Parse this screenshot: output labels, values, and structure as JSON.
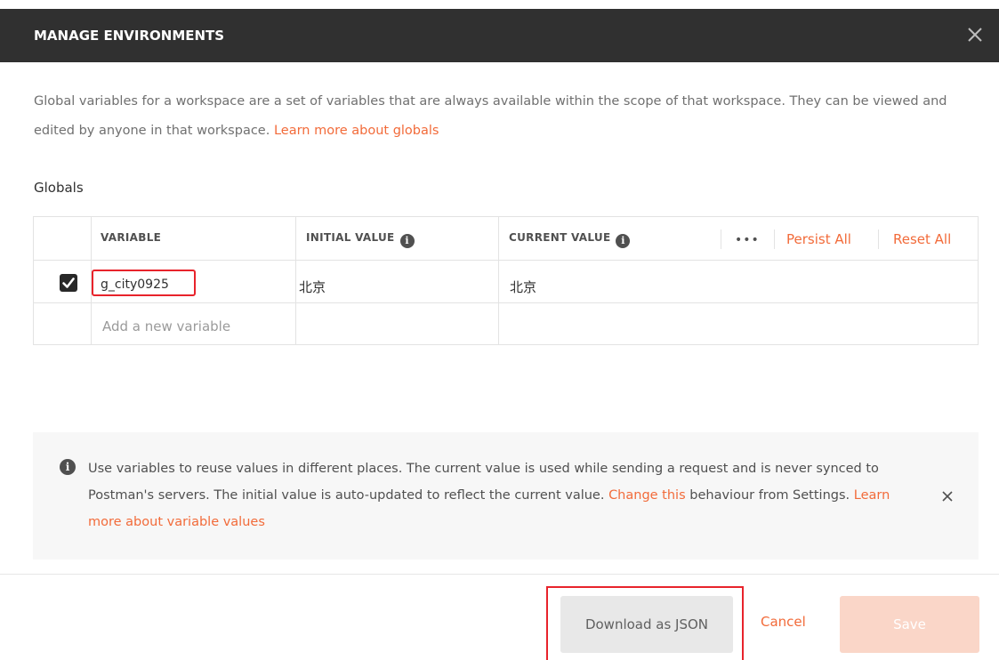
{
  "modal": {
    "title": "MANAGE ENVIRONMENTS",
    "close_icon": "close-icon"
  },
  "description": {
    "text": "Global variables for a workspace are a set of variables that are always available within the scope of that workspace. They can be viewed and edited by anyone in that workspace. ",
    "link": "Learn more about globals"
  },
  "globals": {
    "label": "Globals",
    "columns": {
      "variable": "VARIABLE",
      "initial_value": "INITIAL VALUE",
      "current_value": "CURRENT VALUE",
      "more": "•••",
      "persist_all": "Persist All",
      "reset_all": "Reset All"
    },
    "rows": [
      {
        "checked": true,
        "variable": "g_city0925",
        "initial_value": "北京",
        "current_value": "北京"
      }
    ],
    "new_variable_placeholder": "Add a new variable"
  },
  "notice": {
    "text_1": "Use variables to reuse values in different places. The current value is used while sending a request and is never synced to Postman's servers. The initial value is auto-updated to reflect the current value. ",
    "link_1": "Change this",
    "text_2": " behaviour from Settings. ",
    "link_2": "Learn more about variable values"
  },
  "footer": {
    "download_label": "Download as JSON",
    "cancel_label": "Cancel",
    "save_label": "Save"
  },
  "colors": {
    "header_bg": "#303030",
    "accent": "#f26b3a",
    "highlight": "#e8232b",
    "save_disabled": "#fad6c8"
  }
}
